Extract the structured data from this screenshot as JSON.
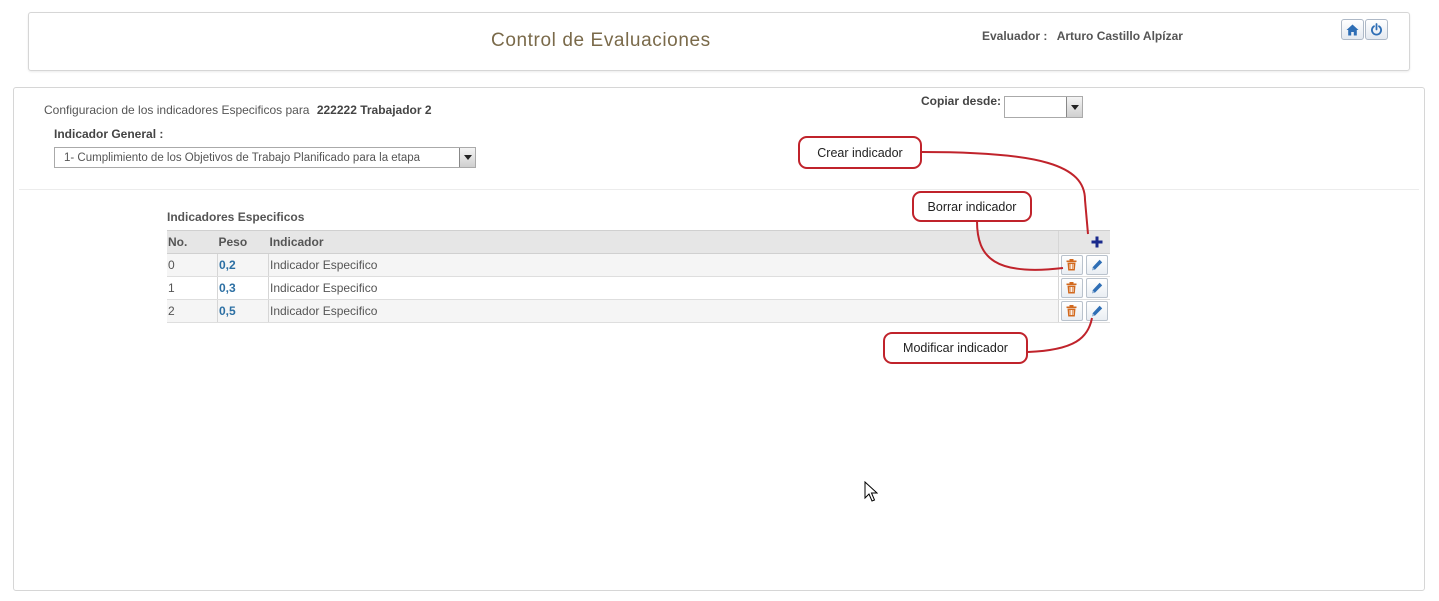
{
  "header": {
    "title": "Control de Evaluaciones",
    "evaluator_label": "Evaluador :",
    "evaluator_name": "Arturo Castillo Alpízar",
    "home_icon": "home-icon",
    "power_icon": "power-icon"
  },
  "config": {
    "prefix": "Configuracion de los indicadores Especificos para",
    "worker": "222222 Trabajador 2",
    "general_label": "Indicador General :",
    "general_value": "1- Cumplimiento de los Objetivos de Trabajo Planificado para la etapa",
    "copy_label": "Copiar desde:",
    "copy_value": ""
  },
  "grid": {
    "title": "Indicadores Especificos",
    "columns": [
      "No.",
      "Peso",
      "Indicador"
    ],
    "rows": [
      {
        "no": "0",
        "peso": "0,2",
        "indicador": "Indicador Especifico"
      },
      {
        "no": "1",
        "peso": "0,3",
        "indicador": "Indicador Especifico"
      },
      {
        "no": "2",
        "peso": "0,5",
        "indicador": "Indicador Especifico"
      }
    ]
  },
  "callouts": {
    "create": "Crear indicador",
    "delete": "Borrar indicador",
    "modify": "Modificar indicador"
  },
  "colors": {
    "title": "#7a6a4a",
    "peso": "#2c6fa3",
    "callout_border": "#c0232b",
    "add_icon": "#1a2a8c",
    "delete_icon": "#d2691e",
    "edit_icon": "#2e6eb5"
  }
}
